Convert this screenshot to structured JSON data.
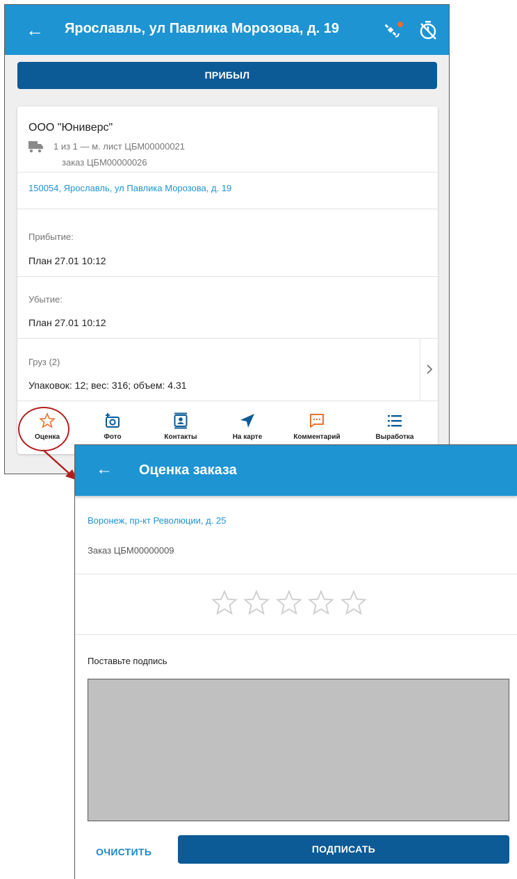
{
  "route_screen": {
    "header": {
      "title": "Ярославль, ул Павлика Морозова, д. 19"
    },
    "arrived_button": "ПРИБЫЛ",
    "card": {
      "client": "ООО \"Юниверс\"",
      "route_line": "1 из 1 — м. лист ЦБМ00000021",
      "order_line": "заказ ЦБМ00000026",
      "address": "150054, Ярославль, ул Павлика Морозова, д. 19",
      "arrival": {
        "label": "Прибытие:",
        "value": "План  27.01 10:12"
      },
      "departure": {
        "label": "Убытие:",
        "value": "План  27.01 10:12"
      },
      "cargo": {
        "label": "Груз  (2)",
        "value": "Упаковок: 12; вес: 316; объем: 4.31"
      }
    },
    "actions": [
      {
        "label": "Оценка",
        "icon": "star-outline-icon",
        "color": "#e8712b"
      },
      {
        "label": "Фото",
        "icon": "camera-add-icon",
        "color": "#0c5a96"
      },
      {
        "label": "Контакты",
        "icon": "contacts-icon",
        "color": "#0c5a96"
      },
      {
        "label": "На карте",
        "icon": "navigation-icon",
        "color": "#0c5a96"
      },
      {
        "label": "Комментарий",
        "icon": "comment-icon",
        "color": "#e8712b"
      },
      {
        "label": "Выработка",
        "icon": "list-icon",
        "color": "#0c5a96"
      }
    ]
  },
  "rating_screen": {
    "header": {
      "title": "Оценка заказа"
    },
    "address": "Воронеж, пр-кт Революции, д. 25",
    "order": "Заказ  ЦБМ00000009",
    "rating": {
      "value": 0,
      "max": 5
    },
    "signature_label": "Поставьте подпись",
    "clear_button": "ОЧИСТИТЬ",
    "sign_button": "ПОДПИСАТЬ"
  },
  "colors": {
    "app_bar": "#1e94d3",
    "primary_button": "#0c5a96",
    "link": "#1e94d3",
    "accent_orange": "#e8712b",
    "highlight_ring": "#b51d1d",
    "signature_pad": "#c0c0c0"
  }
}
